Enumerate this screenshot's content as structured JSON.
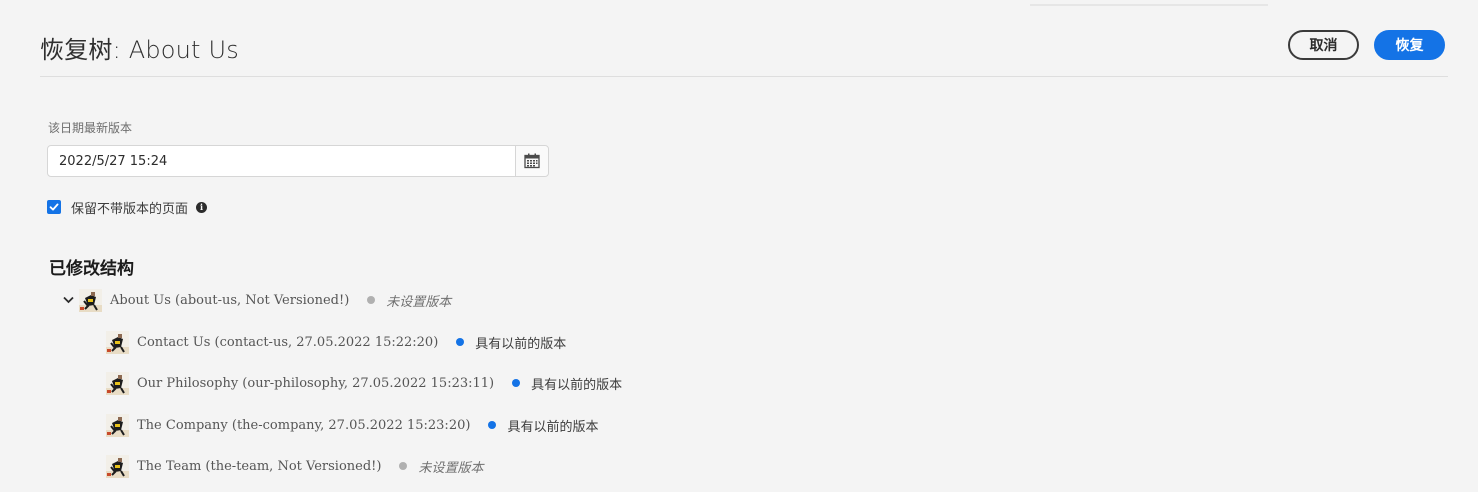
{
  "header": {
    "title": "恢复树: About Us",
    "cancel_label": "取消",
    "restore_label": "恢复"
  },
  "date_section": {
    "label": "该日期最新版本",
    "value": "2022/5/27 15:24",
    "calendar_icon": "calendar-icon"
  },
  "checkbox": {
    "label": "保留不带版本的页面",
    "checked": true,
    "info_icon": "info-icon"
  },
  "tree": {
    "title": "已修改结构",
    "root": {
      "text": "About Us (about-us, Not Versioned!)",
      "status": "未设置版本",
      "status_color": "#b0b0b0",
      "expanded": true
    },
    "children": [
      {
        "text": "Contact Us (contact-us, 27.05.2022 15:22:20)",
        "status": "具有以前的版本",
        "status_color": "#1473e6"
      },
      {
        "text": "Our Philosophy (our-philosophy, 27.05.2022 15:23:11)",
        "status": "具有以前的版本",
        "status_color": "#1473e6"
      },
      {
        "text": "The Company (the-company, 27.05.2022 15:23:20)",
        "status": "具有以前的版本",
        "status_color": "#1473e6"
      },
      {
        "text": "The Team (the-team, Not Versioned!)",
        "status": "未设置版本",
        "status_color": "#b0b0b0"
      }
    ]
  },
  "colors": {
    "accent": "#1473e6",
    "background": "#f4f4f4"
  }
}
